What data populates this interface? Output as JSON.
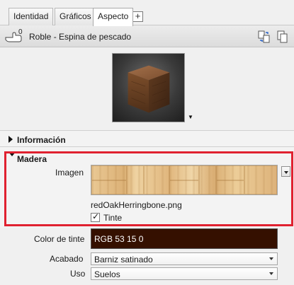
{
  "tabs": [
    {
      "label": "Identidad"
    },
    {
      "label": "Gráficos"
    },
    {
      "label": "Aspecto"
    }
  ],
  "add_tab_label": "+",
  "material": {
    "count": "0",
    "name": "Roble - Espina de pescado"
  },
  "sections": {
    "info_title": "Información",
    "madera_title": "Madera"
  },
  "madera": {
    "image_label": "Imagen",
    "filename": "redOakHerringbone.png",
    "tint_label": "Tinte",
    "tint_checked": true
  },
  "tint_color": {
    "label": "Color de tinte",
    "value": "RGB 53 15 0",
    "hex": "#351000"
  },
  "finish": {
    "label": "Acabado",
    "value": "Barniz satinado"
  },
  "use": {
    "label": "Uso",
    "value": "Suelos"
  },
  "colors": {
    "highlight": "#e02130"
  }
}
